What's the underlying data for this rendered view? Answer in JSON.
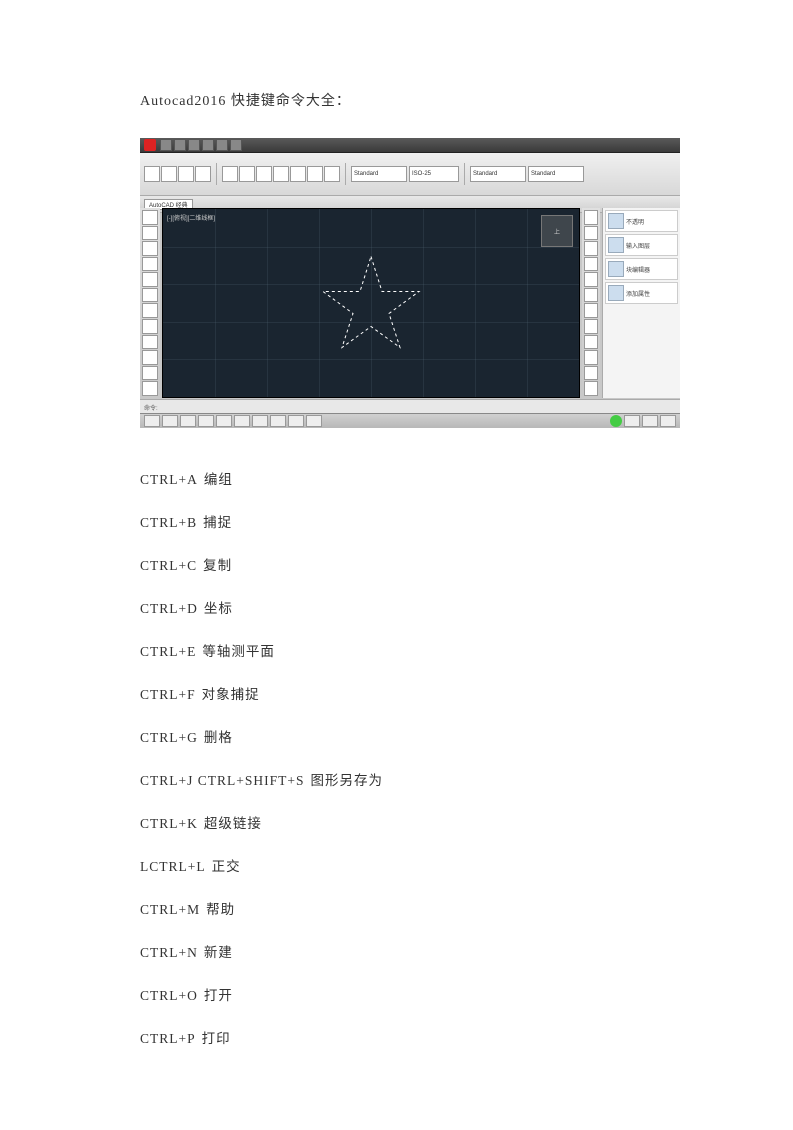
{
  "title": "Autocad2016 快捷键命令大全：",
  "screenshot": {
    "canvas_label": "[-][俯视][二维线框]",
    "viewcube_label": "上",
    "ribbon_combos": [
      "Standard",
      "ISO-25",
      "Standard",
      "Standard"
    ],
    "tabs": [
      "AutoCAD 经典"
    ],
    "panel_items": [
      "不透明",
      "输入图层",
      "块编辑器",
      "添加属性"
    ],
    "cmdline": "命令:"
  },
  "shortcuts": [
    {
      "key": "CTRL+A",
      "desc": "编组"
    },
    {
      "key": "CTRL+B",
      "desc": "捕捉"
    },
    {
      "key": "CTRL+C",
      "desc": "复制"
    },
    {
      "key": "CTRL+D",
      "desc": "坐标"
    },
    {
      "key": "CTRL+E",
      "desc": "等轴测平面"
    },
    {
      "key": "CTRL+F",
      "desc": "对象捕捉"
    },
    {
      "key": "CTRL+G",
      "desc": "删格"
    },
    {
      "key": "CTRL+J CTRL+SHIFT+S",
      "desc": "图形另存为"
    },
    {
      "key": "CTRL+K",
      "desc": "超级链接"
    },
    {
      "key": "LCTRL+L",
      "desc": "正交"
    },
    {
      "key": "CTRL+M",
      "desc": "帮助"
    },
    {
      "key": "CTRL+N",
      "desc": "新建"
    },
    {
      "key": "CTRL+O",
      "desc": "打开"
    },
    {
      "key": "CTRL+P",
      "desc": "打印"
    }
  ]
}
